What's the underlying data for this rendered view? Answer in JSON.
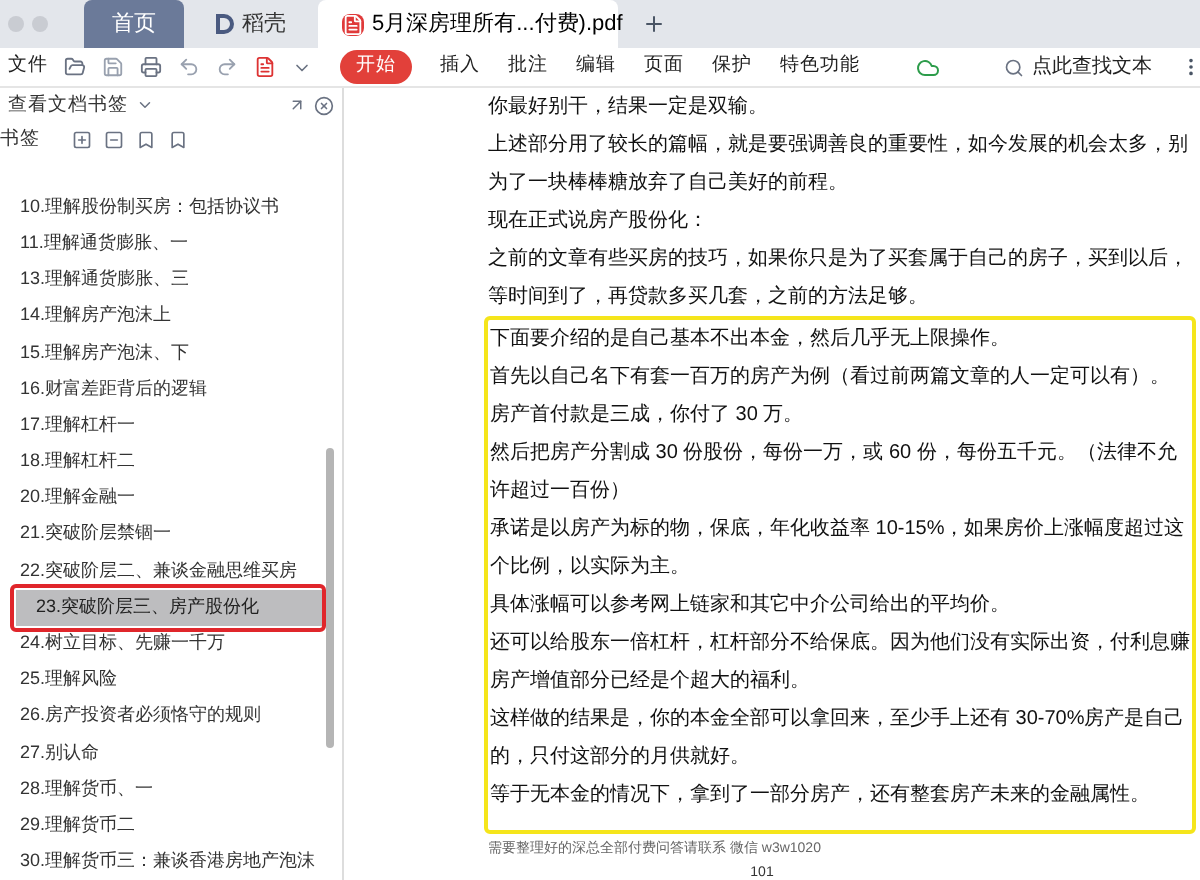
{
  "tabs": [
    {
      "label": "首页",
      "kind": "home",
      "selected": false
    },
    {
      "label": "稻壳",
      "kind": "docer",
      "selected": false
    },
    {
      "label": "5月深房理所有...付费).pdf",
      "kind": "doc",
      "selected": true
    }
  ],
  "toolbar": {
    "file_menu": "文件",
    "menus": [
      {
        "label": "开始",
        "selected": true
      },
      {
        "label": "插入",
        "selected": false
      },
      {
        "label": "批注",
        "selected": false
      },
      {
        "label": "编辑",
        "selected": false
      },
      {
        "label": "页面",
        "selected": false
      },
      {
        "label": "保护",
        "selected": false
      },
      {
        "label": "特色功能",
        "selected": false
      }
    ],
    "search": {
      "placeholder": "点此查找文本"
    }
  },
  "sidebar": {
    "title": "查看文档书签",
    "bookmarks_label": "书签",
    "items": [
      {
        "label": "10.理解股份制买房：包括协议书",
        "selected": false,
        "circled": false
      },
      {
        "label": "11.理解通货膨胀、一",
        "selected": false,
        "circled": false
      },
      {
        "label": "13.理解通货膨胀、三",
        "selected": false,
        "circled": false
      },
      {
        "label": "14.理解房产泡沫上",
        "selected": false,
        "circled": false
      },
      {
        "label": "15.理解房产泡沫、下",
        "selected": false,
        "circled": false
      },
      {
        "label": "16.财富差距背后的逻辑",
        "selected": false,
        "circled": false
      },
      {
        "label": "17.理解杠杆一",
        "selected": false,
        "circled": false
      },
      {
        "label": "18.理解杠杆二",
        "selected": false,
        "circled": false
      },
      {
        "label": "20.理解金融一",
        "selected": false,
        "circled": false
      },
      {
        "label": "21.突破阶层禁锢一",
        "selected": false,
        "circled": false
      },
      {
        "label": "22.突破阶层二、兼谈金融思维买房",
        "selected": false,
        "circled": false
      },
      {
        "label": "23.突破阶层三、房产股份化",
        "selected": true,
        "circled": true
      },
      {
        "label": "24.树立目标、先赚一千万",
        "selected": false,
        "circled": false
      },
      {
        "label": "25.理解风险",
        "selected": false,
        "circled": false
      },
      {
        "label": "26.房产投资者必须恪守的规则",
        "selected": false,
        "circled": false
      },
      {
        "label": "27.别认命",
        "selected": false,
        "circled": false
      },
      {
        "label": "28.理解货币、一",
        "selected": false,
        "circled": false
      },
      {
        "label": "29.理解货币二",
        "selected": false,
        "circled": false
      },
      {
        "label": "30.理解货币三：兼谈香港房地产泡沫",
        "selected": false,
        "circled": false
      }
    ]
  },
  "document": {
    "paragraphs": [
      "你最好别干，结果一定是双输。",
      "上述部分用了较长的篇幅，就是要强调善良的重要性，如今发展的机会太多，别为了一块棒棒糖放弃了自己美好的前程。",
      "现在正式说房产股份化：",
      "之前的文章有些买房的技巧，如果你只是为了买套属于自己的房子，买到以后，等时间到了，再贷款多买几套，之前的方法足够。"
    ],
    "highlight_box": {
      "paragraphs": [
        "下面要介绍的是自己基本不出本金，然后几乎无上限操作。",
        "首先以自己名下有套一百万的房产为例（看过前两篇文章的人一定可以有）。",
        "房产首付款是三成，你付了 30 万。",
        "然后把房产分割成 30 份股份，每份一万，或 60 份，每份五千元。（法律不允许超过一百份）",
        "承诺是以房产为标的物，保底，年化收益率 10-15%，如果房价上涨幅度超过这个比例，以实际为主。",
        "具体涨幅可以参考网上链家和其它中介公司给出的平均价。",
        "还可以给股东一倍杠杆，杠杆部分不给保底。因为他们没有实际出资，付利息赚房产增值部分已经是个超大的福利。",
        "这样做的结果是，你的本金全部可以拿回来，至少手上还有 30-70%房产是自己的，只付这部分的月供就好。",
        "等于无本金的情况下，拿到了一部分房产，还有整套房产未来的金融属性。"
      ]
    },
    "footer": "需要整理好的深总全部付费问答请联系 微信 w3w1020",
    "page_number": "101"
  }
}
